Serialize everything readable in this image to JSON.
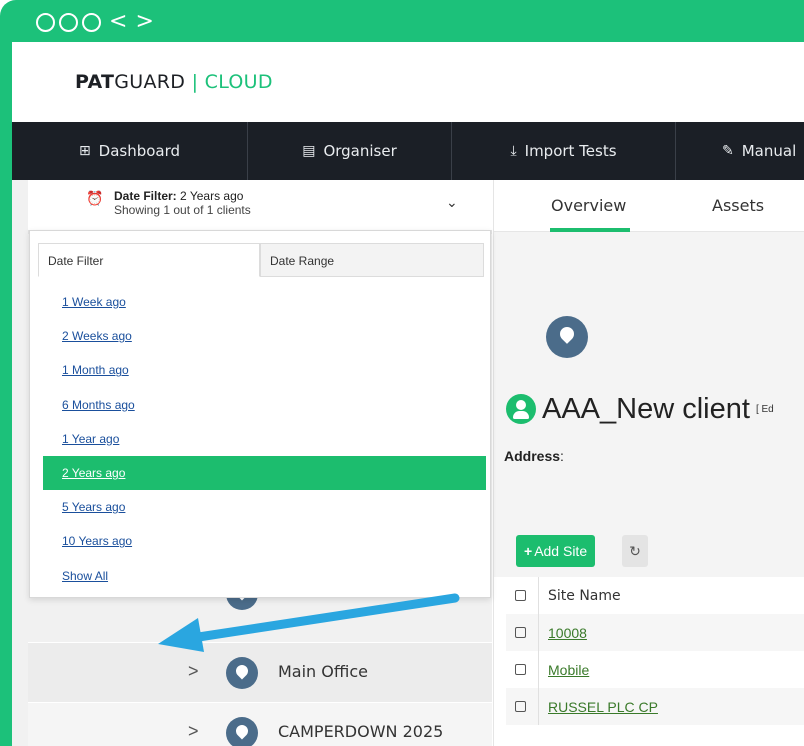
{
  "window": {
    "controls": [
      "close",
      "minimize",
      "maximize"
    ],
    "back": "<",
    "forward": ">"
  },
  "brand": {
    "part1": "PAT",
    "part2": "GUARD",
    "separator": "|",
    "part3": "CLOUD"
  },
  "topnav": [
    {
      "icon": "dashboard-icon",
      "glyph": "⊞",
      "label": "Dashboard"
    },
    {
      "icon": "organiser-icon",
      "glyph": "▤",
      "label": "Organiser"
    },
    {
      "icon": "import-icon",
      "glyph": "⤓",
      "label": "Import Tests"
    },
    {
      "icon": "edit-icon",
      "glyph": "✎",
      "label": "Manual"
    }
  ],
  "date_filter": {
    "title_bold": "Date Filter:",
    "title_value": "2 Years ago",
    "subtitle": "Showing 1 out of 1 clients",
    "tabs": [
      "Date Filter",
      "Date Range"
    ],
    "options": [
      "1 Week ago",
      "2 Weeks ago",
      "1 Month ago",
      "6 Months ago",
      "1 Year ago",
      "2 Years ago",
      "5 Years ago",
      "10 Years ago",
      "Show All"
    ],
    "selected": "2 Years ago"
  },
  "left_sites": [
    "Main Office",
    "CAMPERDOWN 2025"
  ],
  "right": {
    "tabs": [
      "Overview",
      "Assets"
    ],
    "active_tab": "Overview",
    "client_name": "AAA_New client",
    "client_edit": "[ Ed",
    "address_label": "Address",
    "address_colon": ":",
    "add_site_label": "Add Site",
    "add_site_plus": "+",
    "refresh_glyph": "↻",
    "table_header": "Site Name",
    "sites": [
      "10008",
      "Mobile",
      "RUSSEL PLC CP"
    ]
  },
  "colors": {
    "accent": "#1cbd6e",
    "nav_bg": "#1b1f26",
    "pin": "#4b6c8a",
    "arrow": "#2aa6e0"
  }
}
